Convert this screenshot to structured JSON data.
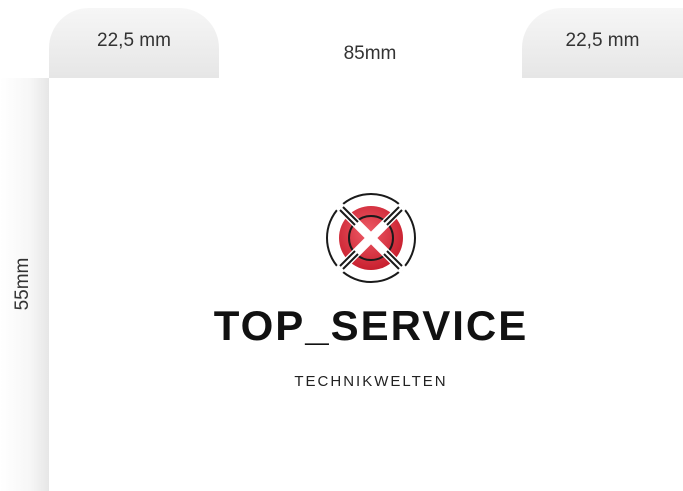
{
  "dimensions": {
    "left_width": "22,5 mm",
    "right_width": "22,5 mm",
    "card_width": "85mm",
    "card_height": "55mm"
  },
  "logo": {
    "icon": "lifebuoy-icon",
    "accent_color": "#d9303e",
    "stroke_color": "#1a1a1a"
  },
  "brand": {
    "name": "TOP_SERVICE",
    "tagline": "TECHNIKWELTEN"
  }
}
